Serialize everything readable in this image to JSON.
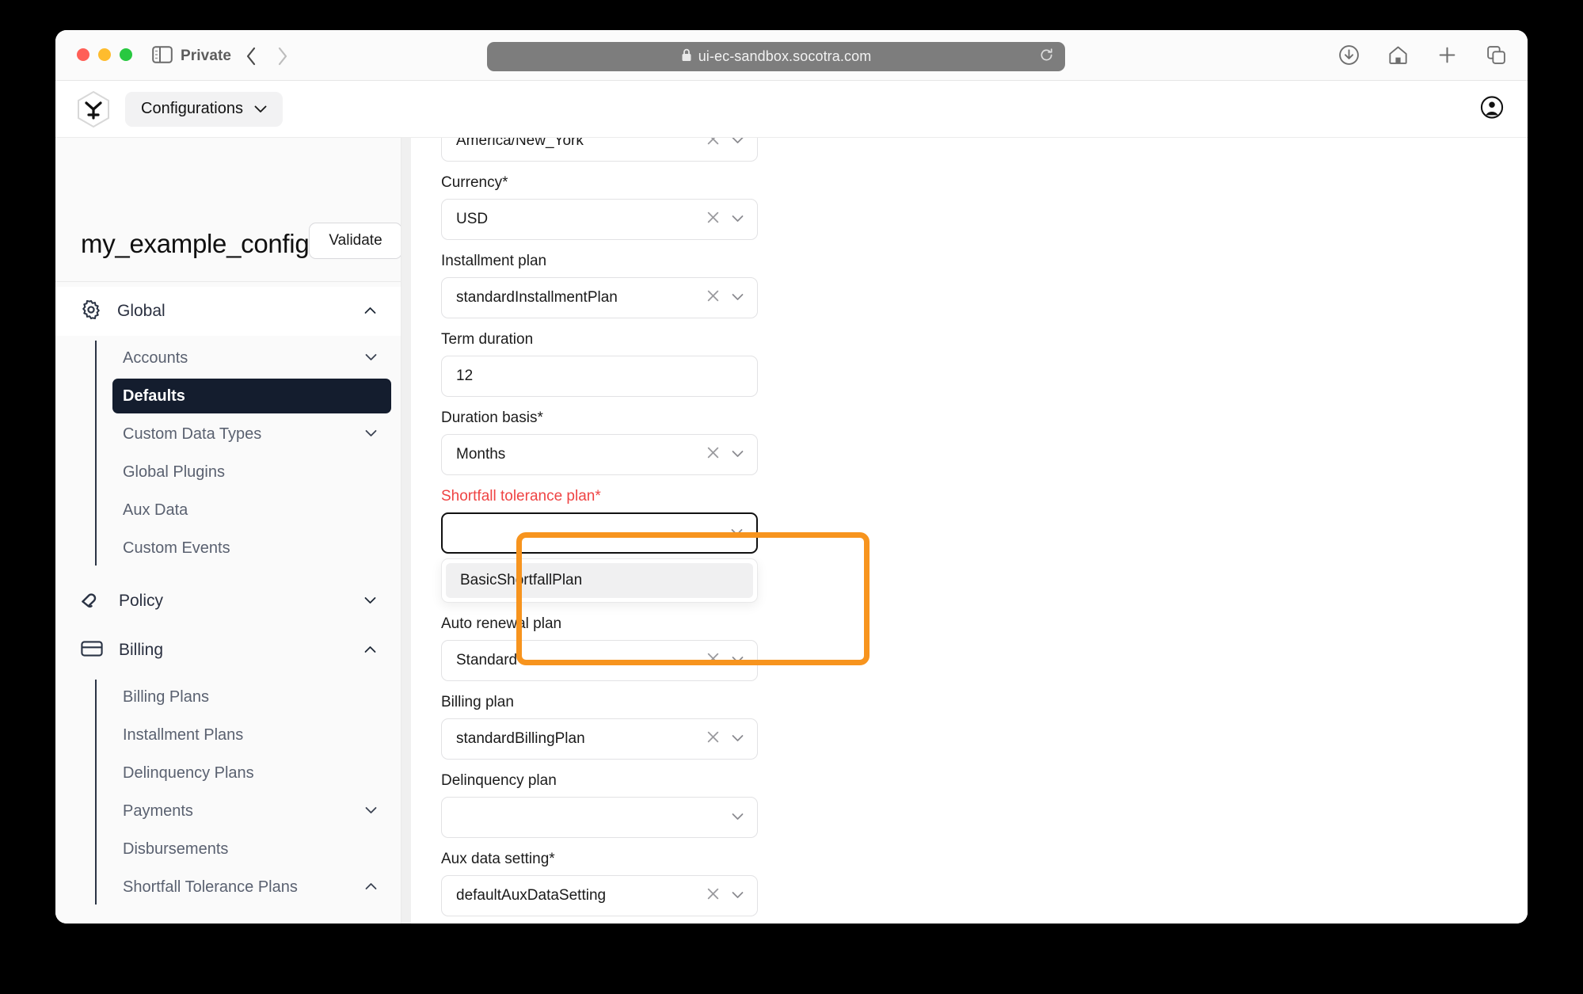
{
  "browser": {
    "mode_label": "Private",
    "url": "ui-ec-sandbox.socotra.com",
    "lock_icon": "lock-icon",
    "reload_icon": "reload-icon",
    "sidebar_toggle_icon": "sidebar-toggle-icon",
    "back_icon": "chevron-left-icon",
    "forward_icon": "chevron-right-icon",
    "toolbar_icons": [
      "downloads-icon",
      "home-icon",
      "new-tab-icon",
      "tab-overview-icon"
    ]
  },
  "appbar": {
    "logo_name": "socotra-logo",
    "configurations_label": "Configurations",
    "configurations_caret": "chevron-down-icon",
    "account_icon": "account-circle-icon"
  },
  "sidebar": {
    "config_title": "my_example_config",
    "validate_label": "Validate",
    "groups": [
      {
        "label": "Global",
        "icon": "gear-icon",
        "caret": "chevron-up-icon",
        "expanded": true,
        "items": [
          {
            "label": "Accounts",
            "caret": "chevron-down-icon",
            "active": false
          },
          {
            "label": "Defaults",
            "caret": "",
            "active": true
          },
          {
            "label": "Custom Data Types",
            "caret": "chevron-down-icon",
            "active": false
          },
          {
            "label": "Global Plugins",
            "caret": "",
            "active": false
          },
          {
            "label": "Aux Data",
            "caret": "",
            "active": false
          },
          {
            "label": "Custom Events",
            "caret": "",
            "active": false
          }
        ]
      },
      {
        "label": "Policy",
        "icon": "policy-hand-icon",
        "caret": "chevron-down-icon",
        "expanded": false,
        "items": []
      },
      {
        "label": "Billing",
        "icon": "credit-card-icon",
        "caret": "chevron-up-icon",
        "expanded": true,
        "items": [
          {
            "label": "Billing Plans",
            "caret": "",
            "active": false
          },
          {
            "label": "Installment Plans",
            "caret": "",
            "active": false
          },
          {
            "label": "Delinquency Plans",
            "caret": "",
            "active": false
          },
          {
            "label": "Payments",
            "caret": "chevron-down-icon",
            "active": false
          },
          {
            "label": "Disbursements",
            "caret": "",
            "active": false
          },
          {
            "label": "Shortfall Tolerance Plans",
            "caret": "chevron-up-icon",
            "active": false
          }
        ]
      }
    ]
  },
  "form": {
    "fields": [
      {
        "label": "",
        "value": "America/New_York",
        "type": "select",
        "clearable": true,
        "state": "normal"
      },
      {
        "label": "Currency*",
        "value": "USD",
        "type": "select",
        "clearable": true,
        "state": "normal"
      },
      {
        "label": "Installment plan",
        "value": "standardInstallmentPlan",
        "type": "select",
        "clearable": true,
        "state": "normal"
      },
      {
        "label": "Term duration",
        "value": "12",
        "type": "text",
        "clearable": false,
        "state": "normal"
      },
      {
        "label": "Duration basis*",
        "value": "Months",
        "type": "select",
        "clearable": true,
        "state": "normal"
      },
      {
        "label": "Shortfall tolerance plan*",
        "value": "",
        "type": "select",
        "clearable": false,
        "state": "error-focused"
      },
      {
        "label": "Auto renewal plan",
        "value": "Standard",
        "type": "select",
        "clearable": true,
        "state": "normal"
      },
      {
        "label": "Billing plan",
        "value": "standardBillingPlan",
        "type": "select",
        "clearable": true,
        "state": "normal"
      },
      {
        "label": "Delinquency plan",
        "value": "",
        "type": "select",
        "clearable": false,
        "state": "normal"
      },
      {
        "label": "Aux data setting*",
        "value": "defaultAuxDataSetting",
        "type": "select",
        "clearable": true,
        "state": "normal"
      }
    ],
    "open_dropdown": {
      "belongs_to": "Shortfall tolerance plan*",
      "options": [
        {
          "label": "BasicShortfallPlan",
          "highlighted": true
        }
      ]
    },
    "icons": {
      "clear": "clear-x-icon",
      "caret": "chevron-down-icon"
    }
  },
  "annotation": {
    "color": "#f7941e",
    "shape": "rectangle-highlight"
  }
}
